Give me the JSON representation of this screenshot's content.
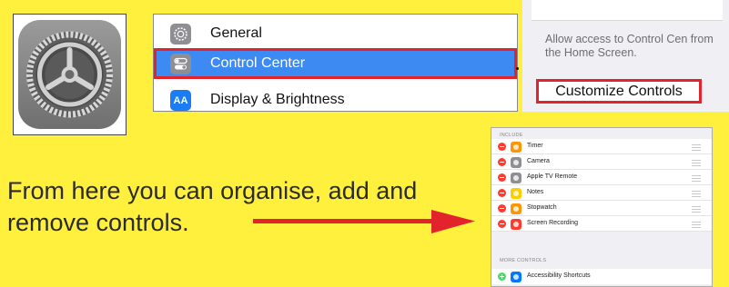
{
  "settings_sidebar": {
    "items": [
      {
        "label": "General",
        "icon": "gear-icon",
        "color": "#8E8E93"
      },
      {
        "label": "Control Center",
        "icon": "toggles-icon",
        "color": "#8E8E93",
        "selected": true
      },
      {
        "label": "Display & Brightness",
        "icon": "AA",
        "color": "#1C7CF4"
      }
    ]
  },
  "description": {
    "text": "Allow access to Control Cen from the Home Screen.",
    "button_label": "Customize Controls"
  },
  "caption": "From here you can organise, add and remove controls.",
  "control_list": {
    "include_header": "INCLUDE",
    "included": [
      {
        "label": "Timer",
        "icon": "timer-icon",
        "color": "#FF9500"
      },
      {
        "label": "Camera",
        "icon": "camera-icon",
        "color": "#8E8E93"
      },
      {
        "label": "Apple TV Remote",
        "icon": "remote-icon",
        "color": "#8E8E93"
      },
      {
        "label": "Notes",
        "icon": "notes-icon",
        "color": "#FFCC00"
      },
      {
        "label": "Stopwatch",
        "icon": "stopwatch-icon",
        "color": "#FF9500"
      },
      {
        "label": "Screen Recording",
        "icon": "screen-recording-icon",
        "color": "#FF3B30"
      }
    ],
    "more_header": "MORE CONTROLS",
    "more": [
      {
        "label": "Accessibility Shortcuts",
        "icon": "accessibility-icon",
        "color": "#007AFF"
      }
    ]
  },
  "colors": {
    "background": "#FEF03C",
    "highlight_red": "#E3232C",
    "selected_blue": "#3D8BF2",
    "remove_red": "#FF3B30",
    "add_green": "#4CD964"
  }
}
